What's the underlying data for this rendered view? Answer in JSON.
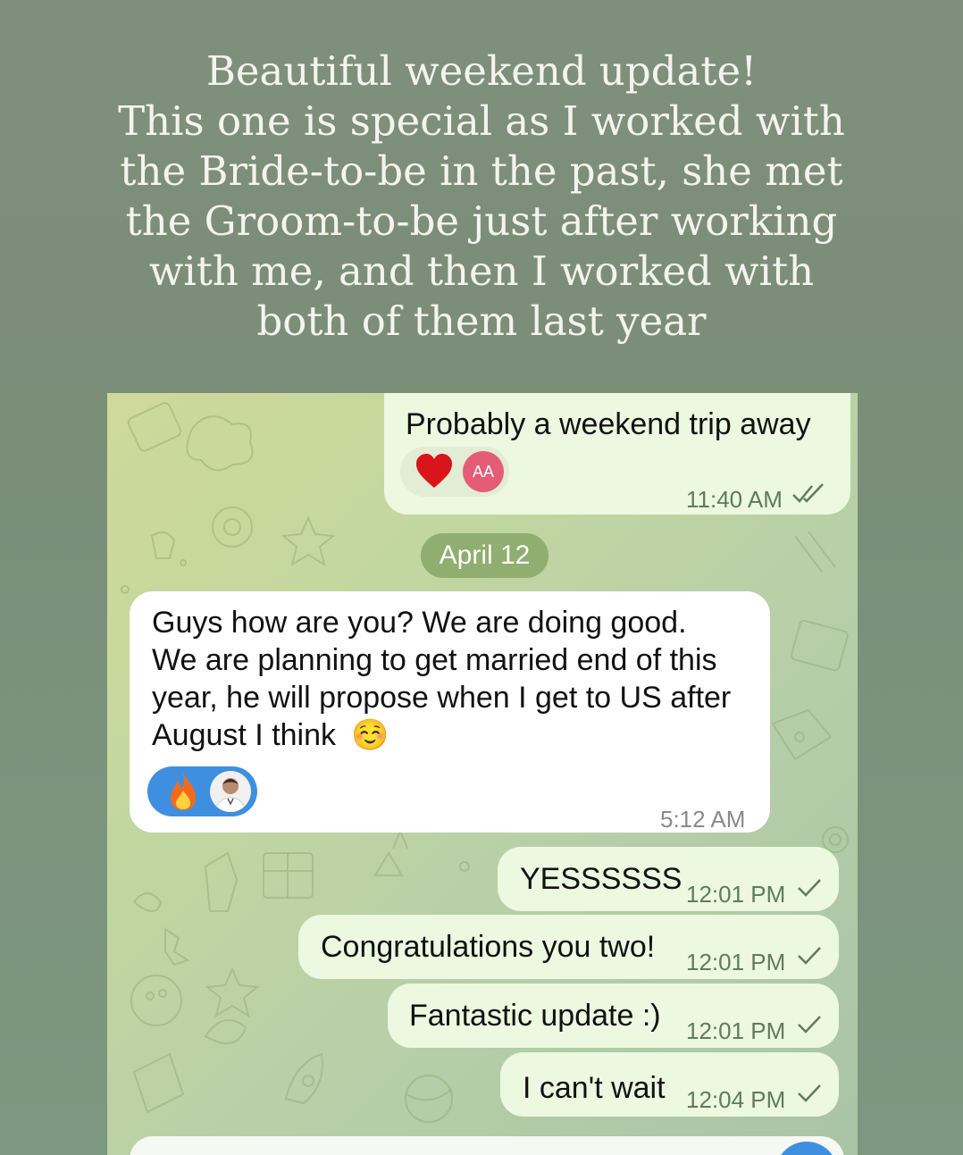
{
  "caption": {
    "lines": [
      "Beautiful weekend update!",
      "This one is special as I worked with",
      "the Bride-to-be in the past, she met",
      "the Groom-to-be just after working",
      "with me, and then I worked with",
      "both of them last year"
    ]
  },
  "chat": {
    "messages": [
      {
        "text": "Probably a weekend trip away",
        "time": "11:40 AM",
        "reaction_avatar": "AA"
      },
      {
        "date": "April 12"
      },
      {
        "lines": [
          "Guys how are you? We are doing good.",
          "We are planning to get married end of this",
          "year, he will propose when I get to US after",
          "August I think"
        ],
        "emoji": "☺️",
        "time": "5:12 AM"
      },
      {
        "text": "YESSSSSS",
        "time": "12:01 PM"
      },
      {
        "text": "Congratulations you two!",
        "time": "12:01 PM"
      },
      {
        "text": "Fantastic update :)",
        "time": "12:01 PM"
      },
      {
        "text": "I can't wait",
        "time": "12:04 PM"
      }
    ]
  },
  "colors": {
    "outgoing_bubble": "#ecf8df",
    "incoming_bubble": "#ffffff",
    "date_pill": "#8fae6f",
    "reaction_out": "#e3ecd5",
    "reaction_in": "#3f8fe0"
  },
  "icons": [
    "heart-icon",
    "fire-icon",
    "double-check-icon",
    "check-icon",
    "user-avatar"
  ]
}
